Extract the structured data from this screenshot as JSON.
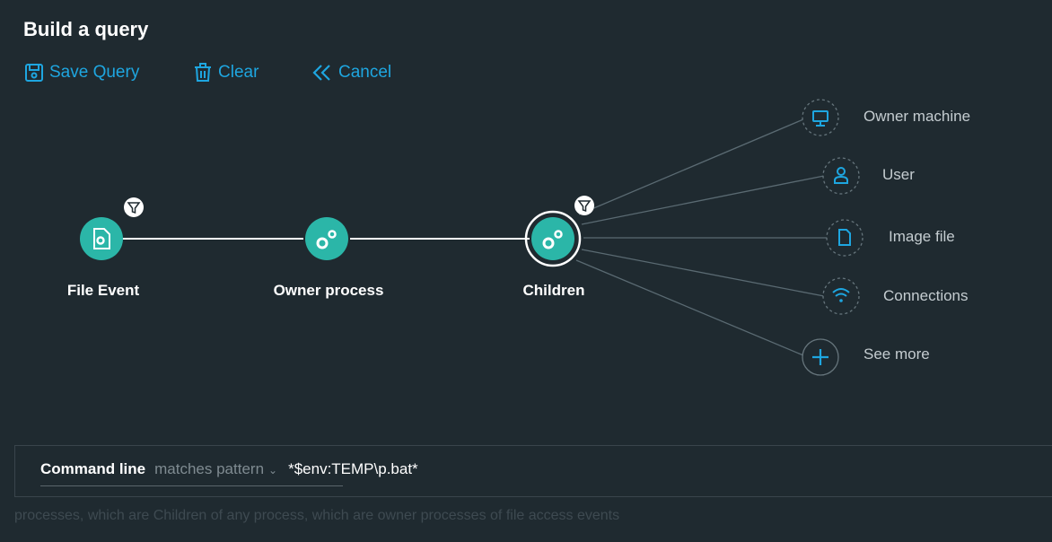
{
  "header": {
    "title": "Build a query"
  },
  "toolbar": {
    "save_label": "Save Query",
    "clear_label": "Clear",
    "cancel_label": "Cancel"
  },
  "graph": {
    "nodes": [
      {
        "label": "File Event",
        "icon": "file-gear-icon",
        "has_filter": true
      },
      {
        "label": "Owner process",
        "icon": "gears-icon",
        "has_filter": false
      },
      {
        "label": "Children",
        "icon": "gears-icon",
        "has_filter": true,
        "selected": true
      }
    ],
    "branches": [
      {
        "label": "Owner machine",
        "icon": "monitor-icon"
      },
      {
        "label": "User",
        "icon": "user-icon"
      },
      {
        "label": "Image file",
        "icon": "document-icon"
      },
      {
        "label": "Connections",
        "icon": "wifi-icon"
      },
      {
        "label": "See more",
        "icon": "plus-icon"
      }
    ]
  },
  "filter": {
    "field": "Command line",
    "operator": "matches pattern",
    "value": "*$env:TEMP\\p.bat*"
  },
  "description": "processes, which are Children of any process, which are owner processes of file access events",
  "colors": {
    "background": "#1f2a30",
    "accent": "#1ea6e0",
    "node_fill": "#2bb6a8",
    "text": "#ffffff",
    "muted": "#7f8b91"
  }
}
